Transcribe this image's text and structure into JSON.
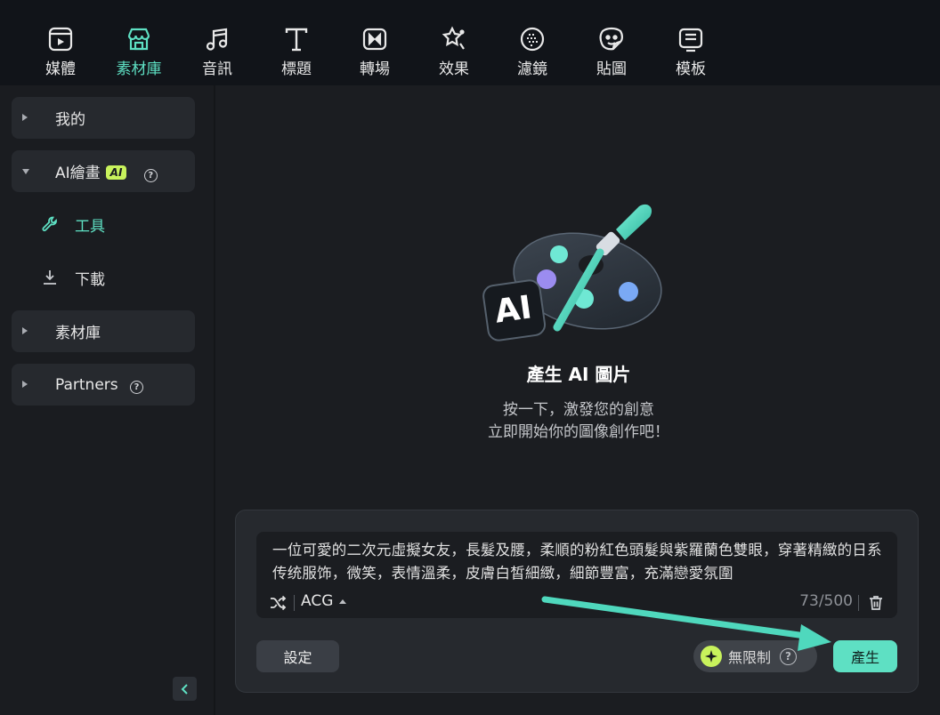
{
  "toolbar": {
    "items": [
      {
        "label": "媒體",
        "icon": "media-icon"
      },
      {
        "label": "素材庫",
        "icon": "store-icon"
      },
      {
        "label": "音訊",
        "icon": "music-note-icon"
      },
      {
        "label": "標題",
        "icon": "text-t-icon"
      },
      {
        "label": "轉場",
        "icon": "transition-icon"
      },
      {
        "label": "效果",
        "icon": "effects-icon"
      },
      {
        "label": "濾鏡",
        "icon": "filter-icon"
      },
      {
        "label": "貼圖",
        "icon": "sticker-icon"
      },
      {
        "label": "模板",
        "icon": "template-icon"
      }
    ],
    "active_index": 1
  },
  "sidebar": {
    "my_label": "我的",
    "ai_drawing_label": "AI繪畫",
    "ai_badge": "AI",
    "tools_label": "工具",
    "download_label": "下載",
    "library_label": "素材庫",
    "partners_label": "Partners"
  },
  "hero": {
    "title": "產生 AI 圖片",
    "subtitle_line1": "按一下，激發您的創意",
    "subtitle_line2": "立即開始你的圖像創作吧！",
    "image_text": "AI"
  },
  "prompt": {
    "text": "一位可愛的二次元虛擬女友，長髮及腰，柔順的粉紅色頭髮與紫羅蘭色雙眼，穿著精緻的日系传统服饰，微笑，表情溫柔，皮膚白皙細緻，細節豐富，充滿戀愛氛圍",
    "style": "ACG",
    "counter": "73/500"
  },
  "actions": {
    "settings_label": "設定",
    "unlimited_label": "無限制",
    "generate_label": "產生"
  },
  "colors": {
    "accent": "#5ee0c3",
    "badge": "#c8f25c",
    "panel": "#26292e",
    "background": "#1b1d21"
  }
}
